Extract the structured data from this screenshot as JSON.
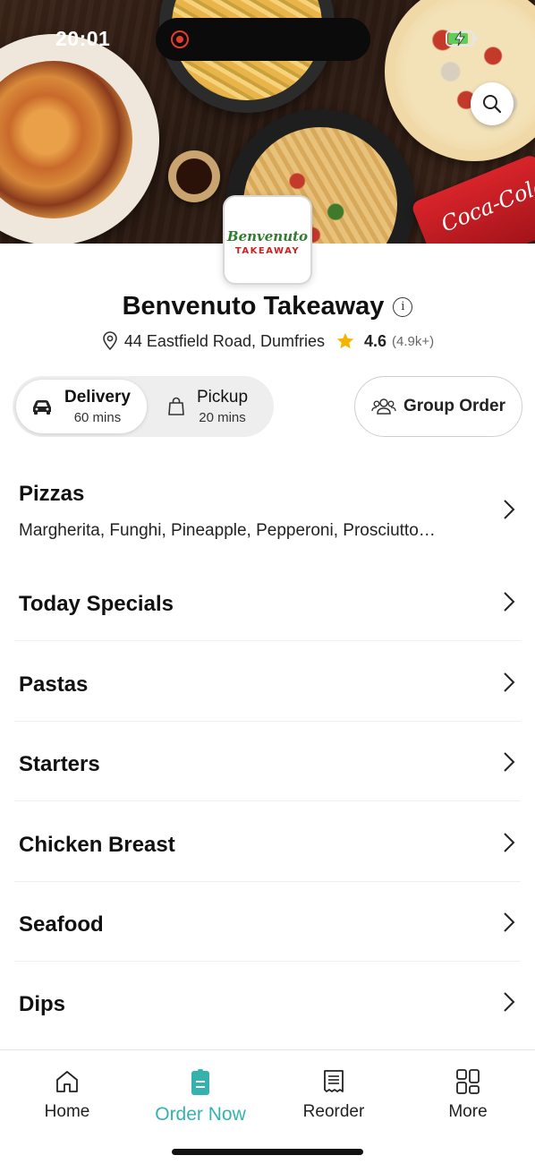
{
  "status_bar": {
    "time": "20:01",
    "battery_level": 0.85
  },
  "restaurant": {
    "name": "Benvenuto Takeaway",
    "logo_line1": "Benvenuto",
    "logo_line2": "TAKEAWAY",
    "address": "44 Eastfield Road, Dumfries",
    "rating": "4.6",
    "rating_count": "(4.9k+)"
  },
  "fulfillment": {
    "delivery": {
      "label": "Delivery",
      "time": "60 mins",
      "selected": true
    },
    "pickup": {
      "label": "Pickup",
      "time": "20 mins",
      "selected": false
    },
    "group_order_label": "Group Order"
  },
  "categories": [
    {
      "name": "Pizzas",
      "description": "Margherita, Funghi, Pineapple, Pepperoni, Prosciutto…"
    },
    {
      "name": "Today Specials"
    },
    {
      "name": "Pastas"
    },
    {
      "name": "Starters"
    },
    {
      "name": "Chicken Breast"
    },
    {
      "name": "Seafood"
    },
    {
      "name": "Dips"
    }
  ],
  "hero_can_text": "Coca-Cola",
  "tab_bar": {
    "home": "Home",
    "order_now": "Order Now",
    "reorder": "Reorder",
    "more": "More",
    "active": "order_now"
  },
  "colors": {
    "accent": "#36b2ae",
    "rating_star": "#f5b400",
    "record": "#e53b2f"
  }
}
